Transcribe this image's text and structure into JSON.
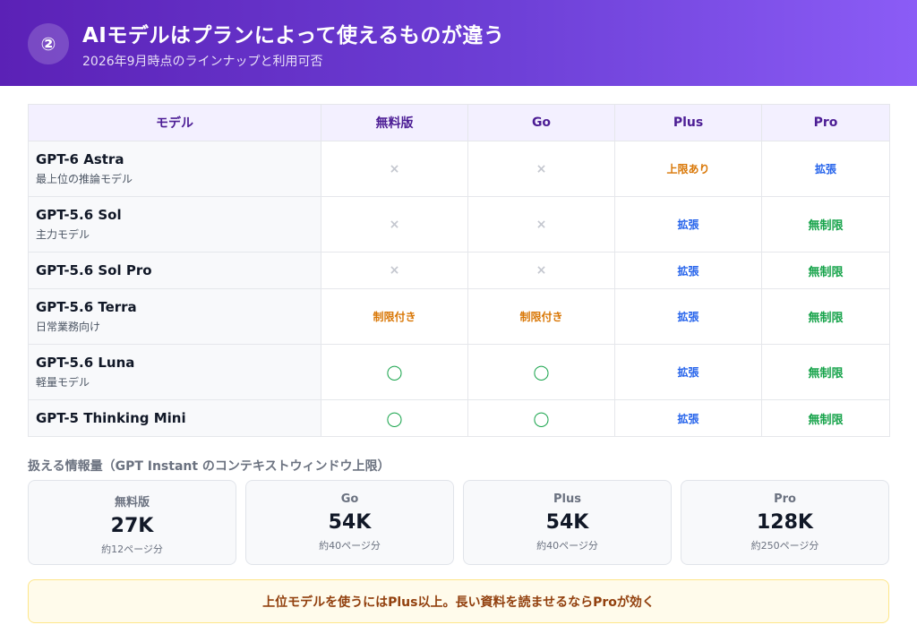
{
  "header": {
    "badge": "②",
    "title": "AIモデルはプランによって使えるものが違う",
    "subtitle": "2026年9月時点のラインナップと利用可否"
  },
  "table": {
    "columns": [
      "モデル",
      "無料版",
      "Go",
      "Plus",
      "Pro"
    ],
    "rows": [
      {
        "name": "GPT-6 Astra",
        "desc": "最上位の推論モデル",
        "cells": [
          {
            "text": "×",
            "kind": "x"
          },
          {
            "text": "×",
            "kind": "x"
          },
          {
            "text": "上限あり",
            "kind": "orange"
          },
          {
            "text": "拡張",
            "kind": "blue"
          }
        ]
      },
      {
        "name": "GPT-5.6 Sol",
        "desc": "主力モデル",
        "cells": [
          {
            "text": "×",
            "kind": "x"
          },
          {
            "text": "×",
            "kind": "x"
          },
          {
            "text": "拡張",
            "kind": "blue"
          },
          {
            "text": "無制限",
            "kind": "green"
          }
        ]
      },
      {
        "name": "GPT-5.6 Sol Pro",
        "desc": "",
        "cells": [
          {
            "text": "×",
            "kind": "x"
          },
          {
            "text": "×",
            "kind": "x"
          },
          {
            "text": "拡張",
            "kind": "blue"
          },
          {
            "text": "無制限",
            "kind": "green"
          }
        ]
      },
      {
        "name": "GPT-5.6 Terra",
        "desc": "日常業務向け",
        "cells": [
          {
            "text": "制限付き",
            "kind": "orange"
          },
          {
            "text": "制限付き",
            "kind": "orange"
          },
          {
            "text": "拡張",
            "kind": "blue"
          },
          {
            "text": "無制限",
            "kind": "green"
          }
        ]
      },
      {
        "name": "GPT-5.6 Luna",
        "desc": "軽量モデル",
        "cells": [
          {
            "text": "◯",
            "kind": "circle"
          },
          {
            "text": "◯",
            "kind": "circle"
          },
          {
            "text": "拡張",
            "kind": "blue"
          },
          {
            "text": "無制限",
            "kind": "green"
          }
        ]
      },
      {
        "name": "GPT-5 Thinking Mini",
        "desc": "",
        "cells": [
          {
            "text": "◯",
            "kind": "circle"
          },
          {
            "text": "◯",
            "kind": "circle"
          },
          {
            "text": "拡張",
            "kind": "blue"
          },
          {
            "text": "無制限",
            "kind": "green"
          }
        ]
      }
    ]
  },
  "context": {
    "label": "扱える情報量（GPT Instant のコンテキストウィンドウ上限）",
    "cards": [
      {
        "plan": "無料版",
        "value": "27K",
        "note": "約12ページ分"
      },
      {
        "plan": "Go",
        "value": "54K",
        "note": "約40ページ分"
      },
      {
        "plan": "Plus",
        "value": "54K",
        "note": "約40ページ分"
      },
      {
        "plan": "Pro",
        "value": "128K",
        "note": "約250ページ分"
      }
    ]
  },
  "notice": "上位モデルを使うにはPlus以上。長い資料を読ませるならProが効く",
  "colors": {
    "header_start": "#5b21b6",
    "header_end": "#8b5cf6",
    "status_orange": "#d97706",
    "status_blue": "#2563eb",
    "status_green": "#16a34a"
  }
}
